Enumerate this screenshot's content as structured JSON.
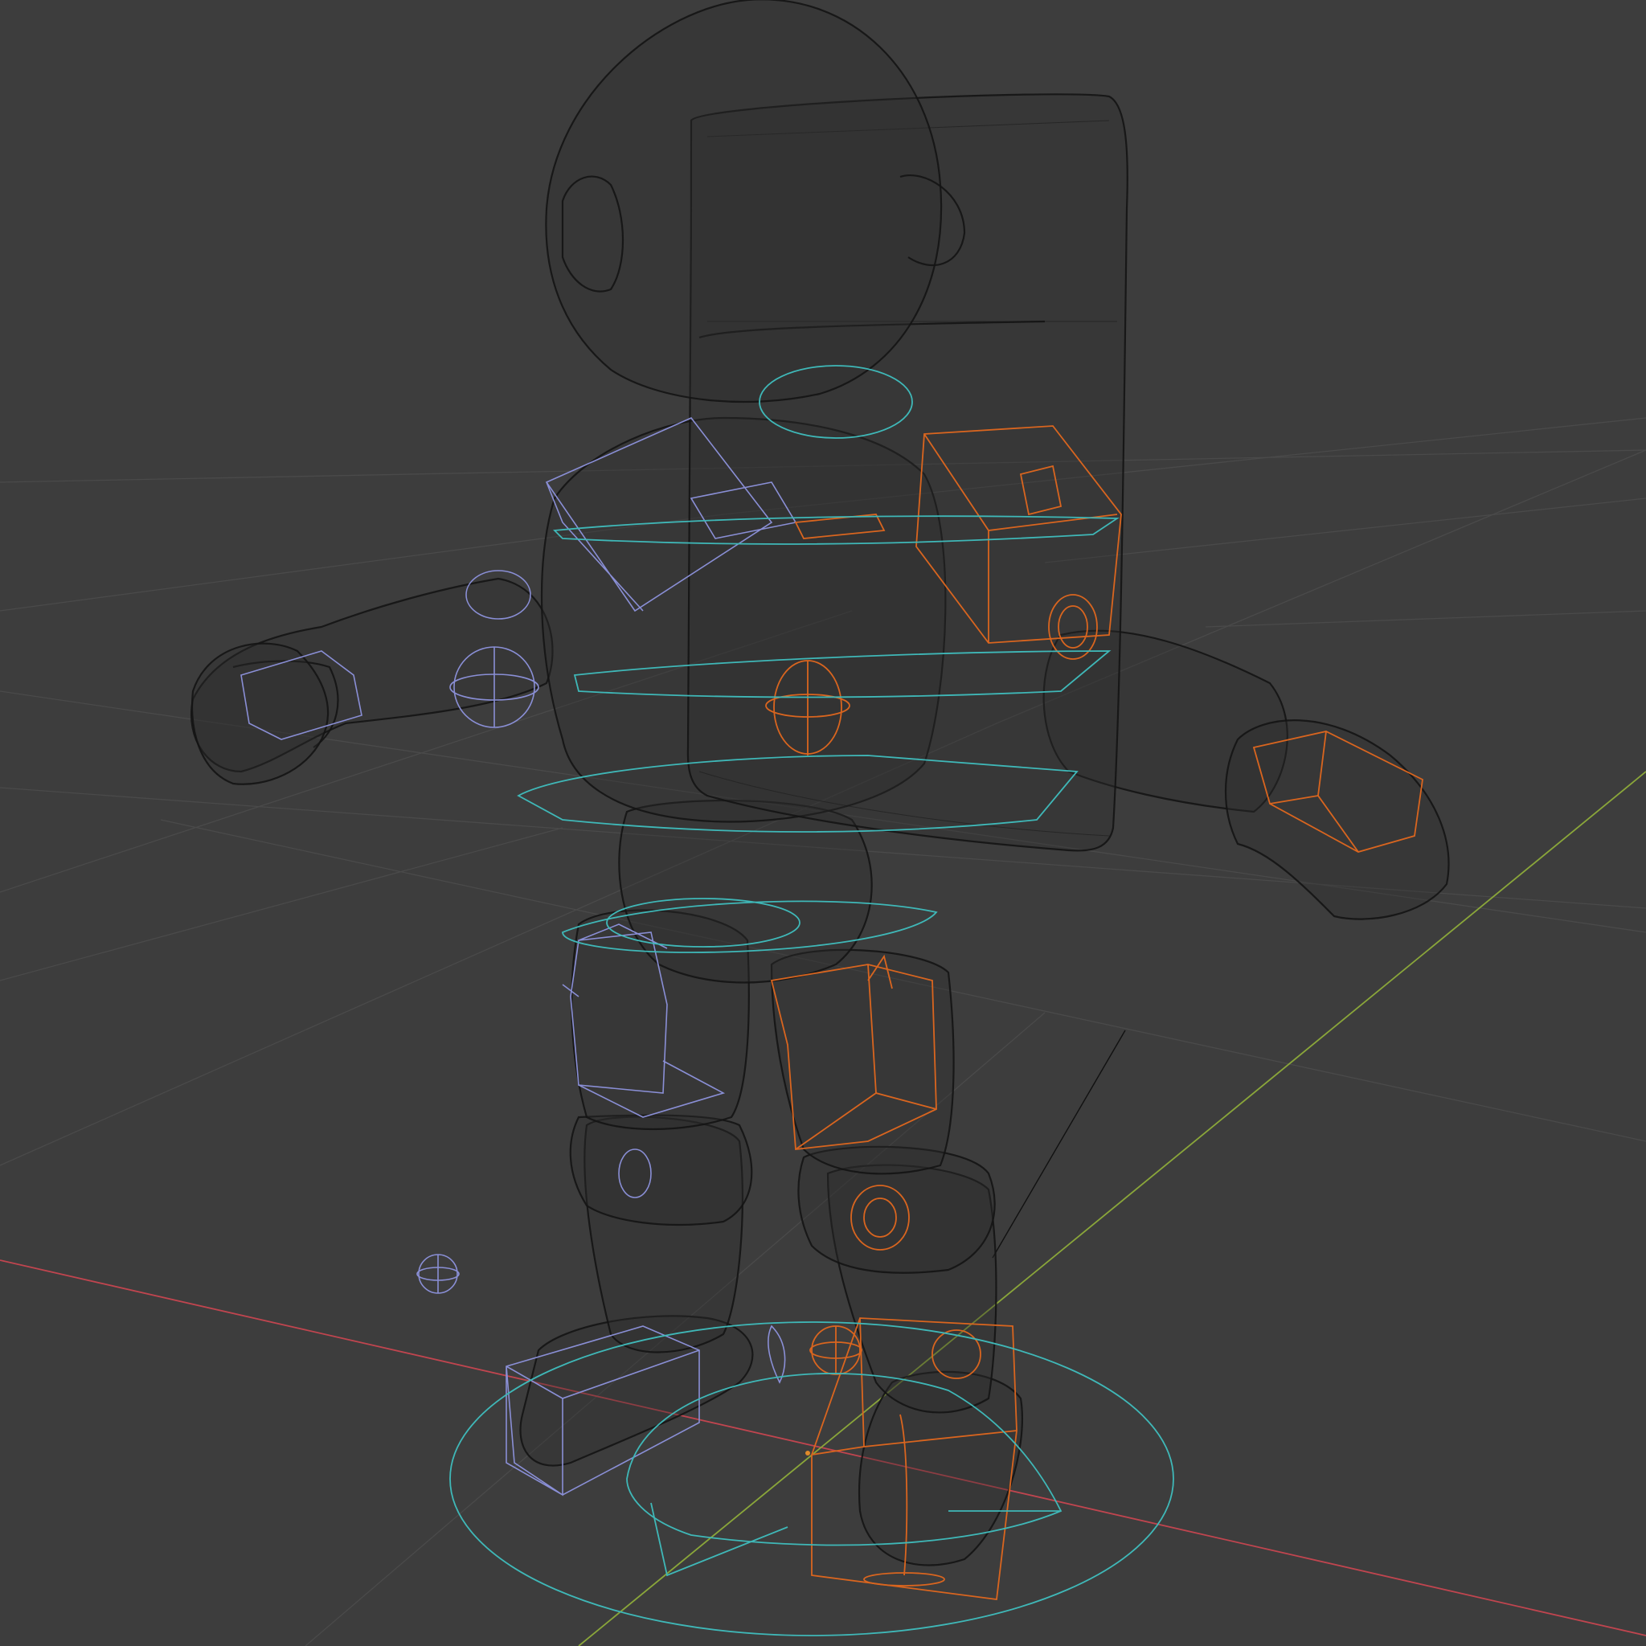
{
  "viewport": {
    "mode": "wireframe",
    "object": "astronaut-rig",
    "colors": {
      "background": "#3d3d3d",
      "grid": "#4a4a4a",
      "x_axis": "#c0454f",
      "y_axis": "#8aa63a",
      "mesh": "#141414",
      "left_controls": "#8a8fd6",
      "right_controls": "#d9651f",
      "center_controls": "#3fb8b8"
    }
  }
}
